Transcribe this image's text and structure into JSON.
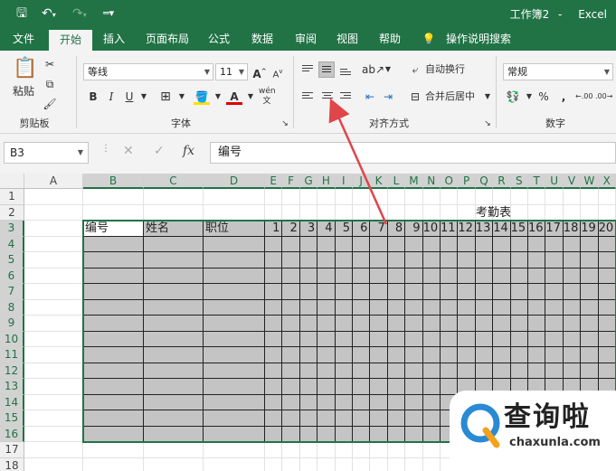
{
  "titlebar": {
    "doc_title": "工作簿2",
    "app_name": "Excel",
    "save_icon": "save-icon",
    "undo_icon": "undo-icon",
    "redo_icon": "redo-icon",
    "customize_icon": "customize-quick-access-icon"
  },
  "tabs": [
    "文件",
    "开始",
    "插入",
    "页面布局",
    "公式",
    "数据",
    "审阅",
    "视图",
    "帮助"
  ],
  "tell_me": "操作说明搜索",
  "ribbon": {
    "clipboard": {
      "paste": "粘贴",
      "label": "剪贴板"
    },
    "font": {
      "name": "等线",
      "size": "11",
      "bold": "B",
      "italic": "I",
      "underline": "U",
      "label": "字体",
      "grow": "A",
      "shrink": "A",
      "font_color": "A",
      "wen": "wén"
    },
    "alignment": {
      "wrap": "自动换行",
      "merge": "合并后居中",
      "label": "对齐方式"
    },
    "number": {
      "format": "常规",
      "label": "数字",
      "percent": "%",
      "comma": ","
    }
  },
  "formula_bar": {
    "name_box": "B3",
    "cancel": "✕",
    "enter": "✓",
    "fx": "fx",
    "content": "编号"
  },
  "sheet": {
    "columns": [
      "A",
      "B",
      "C",
      "D",
      "E",
      "F",
      "G",
      "H",
      "I",
      "J",
      "K",
      "L",
      "M",
      "N",
      "O",
      "P",
      "Q",
      "R",
      "S",
      "T",
      "U",
      "V",
      "W",
      "X"
    ],
    "rows": [
      "1",
      "2",
      "3",
      "4",
      "5",
      "6",
      "7",
      "8",
      "9",
      "10",
      "11",
      "12",
      "13",
      "14",
      "15",
      "16",
      "17",
      "18"
    ],
    "title": "考勤表",
    "headers": [
      "编号",
      "姓名",
      "职位"
    ],
    "day_numbers": [
      "1",
      "2",
      "3",
      "4",
      "5",
      "6",
      "7",
      "8",
      "9",
      "10",
      "11",
      "12",
      "13",
      "14",
      "15",
      "16",
      "17",
      "18",
      "19",
      "20"
    ]
  },
  "watermark": {
    "main": "查询啦",
    "sub": "chaxunla.com"
  },
  "colors": {
    "brand": "#217346",
    "shade": "#c4c4c4",
    "arrow": "#e0454a"
  }
}
